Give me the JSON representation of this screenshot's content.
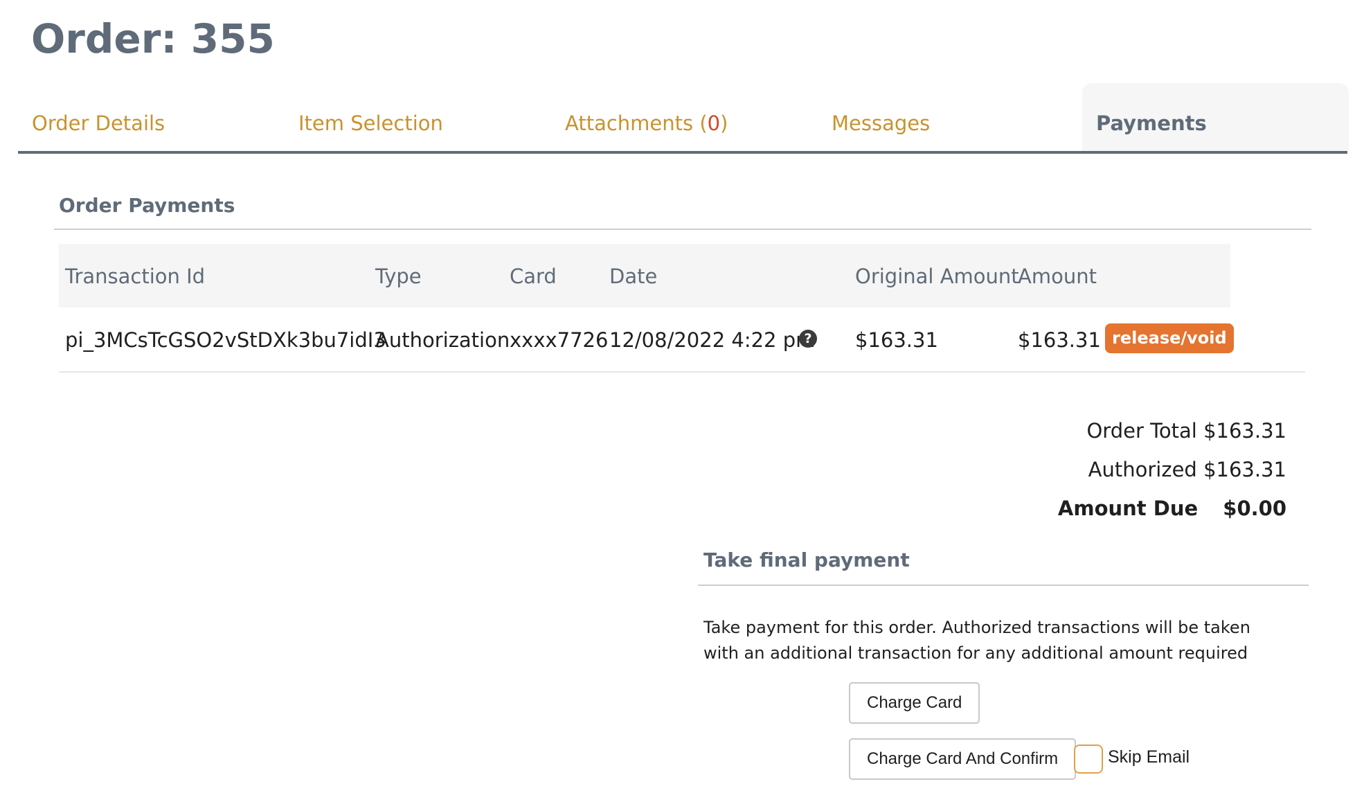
{
  "order": {
    "title": "Order: 355"
  },
  "tabs": [
    {
      "label": "Order Details",
      "count": ""
    },
    {
      "label": "Item Selection",
      "count": ""
    },
    {
      "label": "Attachments (",
      "count": "0",
      "suffix": ")"
    },
    {
      "label": "Messages",
      "count": ""
    },
    {
      "label": "Payments",
      "count": "",
      "active": true
    }
  ],
  "payments": {
    "section_title": "Order Payments",
    "columns": [
      "Transaction Id",
      "Type",
      "Card",
      "Date",
      "Original Amount",
      "Amount"
    ],
    "rows": [
      {
        "transaction_id": "pi_3MCsTcGSO2vStDXk3bu7idI3",
        "type": "Authorization",
        "card": "xxxx7726",
        "date": "12/08/2022 4:22 pm",
        "original_amount": "$163.31",
        "amount": "$163.31",
        "action": "release/void",
        "help_icon": "question-circle-icon"
      }
    ]
  },
  "totals": {
    "order_total_label": "Order Total",
    "order_total": "$163.31",
    "authorized_label": "Authorized",
    "authorized": "$163.31",
    "amount_due_label": "Amount Due",
    "amount_due": "$0.00"
  },
  "final_payment": {
    "title": "Take final payment",
    "description": "Take payment for this order. Authorized transactions will be taken with an additional transaction for any additional amount required",
    "charge_button": "Charge Card",
    "charge_confirm_button": "Charge Card And Confirm",
    "skip_email_label": "Skip Email"
  },
  "colors": {
    "heading": "#5f6b78",
    "tab_link": "#c9922e",
    "badge": "#e4742f",
    "checkbox_border": "#e0a146"
  }
}
